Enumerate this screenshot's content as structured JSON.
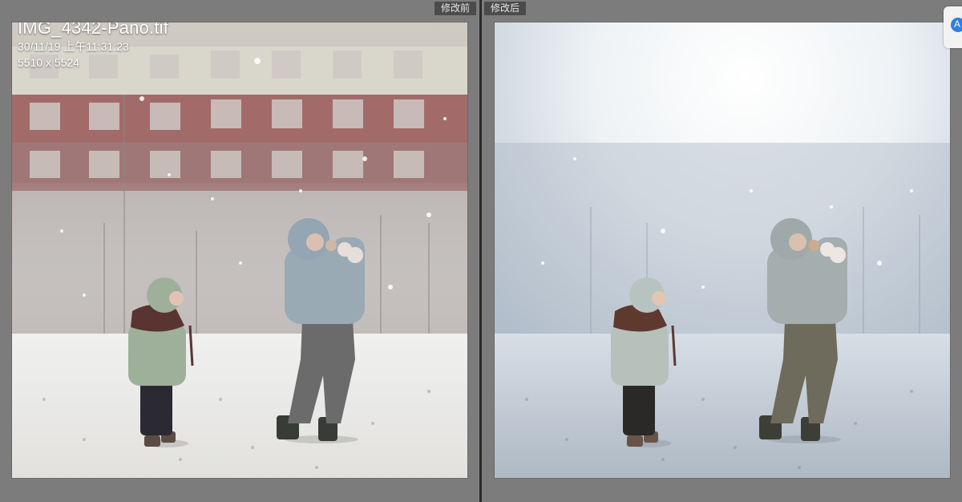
{
  "panes": {
    "before": {
      "label": "修改前"
    },
    "after": {
      "label": "修改后"
    }
  },
  "photo_info": {
    "filename": "IMG_4342-Pano.tif",
    "datetime": "30/11/19 上午11:31:23",
    "dimensions": "5510 x 5524"
  },
  "colors": {
    "background": "#7d7d7d",
    "divider": "#2b2b2b",
    "label_bg": "#4b4b4b",
    "app_icon": "#2f7fe0"
  },
  "icons": {
    "app_icon": "translate-app-icon"
  }
}
